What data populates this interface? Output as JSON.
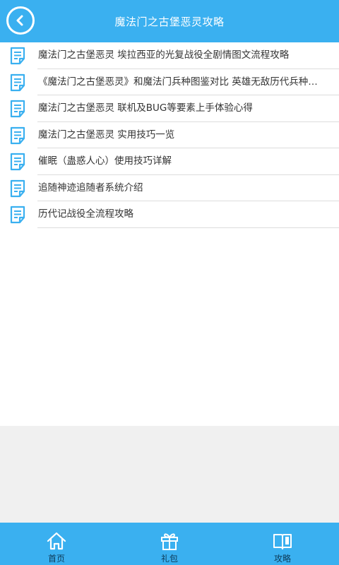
{
  "header": {
    "title": "魔法门之古堡恶灵攻略",
    "back_icon": "chevron-left-icon"
  },
  "list": {
    "icon": "document-icon",
    "items": [
      {
        "label": "魔法门之古堡恶灵 埃拉西亚的光复战役全剧情图文流程攻略"
      },
      {
        "label": "《魔法门之古堡恶灵》和魔法门兵种图鉴对比 英雄无敌历代兵种对比"
      },
      {
        "label": "魔法门之古堡恶灵 联机及BUG等要素上手体验心得"
      },
      {
        "label": "魔法门之古堡恶灵 实用技巧一览"
      },
      {
        "label": "催眠（蛊惑人心）使用技巧详解"
      },
      {
        "label": "追随神迹追随者系统介绍"
      },
      {
        "label": "历代记战役全流程攻略"
      }
    ]
  },
  "bottom_nav": {
    "tabs": [
      {
        "label": "首页",
        "icon": "home-icon"
      },
      {
        "label": "礼包",
        "icon": "gift-icon"
      },
      {
        "label": "攻略",
        "icon": "book-icon"
      }
    ]
  },
  "colors": {
    "accent": "#3ab0f0",
    "nav_text": "#0d3a57",
    "text": "#333333",
    "divider": "#dcdcdc",
    "empty_bg": "#f0f0f0"
  }
}
